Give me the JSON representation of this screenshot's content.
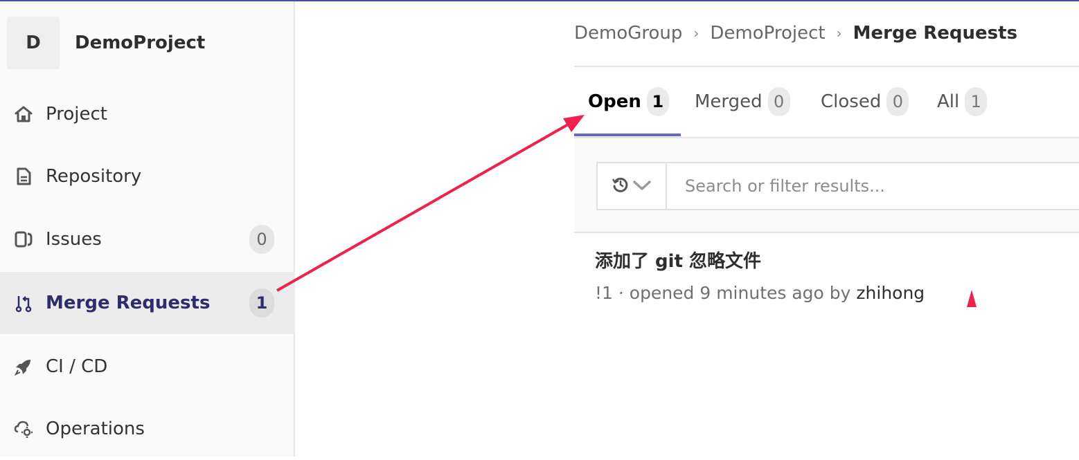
{
  "colors": {
    "accent": "#6666c4",
    "active_nav_text": "#2d2d6e",
    "annotation": "#f0224b"
  },
  "sidebar": {
    "avatar_letter": "D",
    "project_name": "DemoProject",
    "items": [
      {
        "label": "Project",
        "icon": "home-icon"
      },
      {
        "label": "Repository",
        "icon": "document-icon"
      },
      {
        "label": "Issues",
        "icon": "issues-icon",
        "badge": "0"
      },
      {
        "label": "Merge Requests",
        "icon": "merge-request-icon",
        "badge": "1",
        "active": true
      },
      {
        "label": "CI / CD",
        "icon": "rocket-icon"
      },
      {
        "label": "Operations",
        "icon": "cloud-gear-icon"
      }
    ]
  },
  "breadcrumb": {
    "items": [
      "DemoGroup",
      "DemoProject",
      "Merge Requests"
    ],
    "separator": "›"
  },
  "tabs": [
    {
      "label": "Open",
      "count": "1",
      "active": true
    },
    {
      "label": "Merged",
      "count": "0"
    },
    {
      "label": "Closed",
      "count": "0"
    },
    {
      "label": "All",
      "count": "1"
    }
  ],
  "filter": {
    "history_icon": "history-icon",
    "dropdown_icon": "chevron-down-icon",
    "placeholder": "Search or filter results..."
  },
  "merge_requests": [
    {
      "title": "添加了 git 忽略文件",
      "meta": "!1 · opened 9 minutes ago by",
      "author": "zhihong"
    }
  ]
}
